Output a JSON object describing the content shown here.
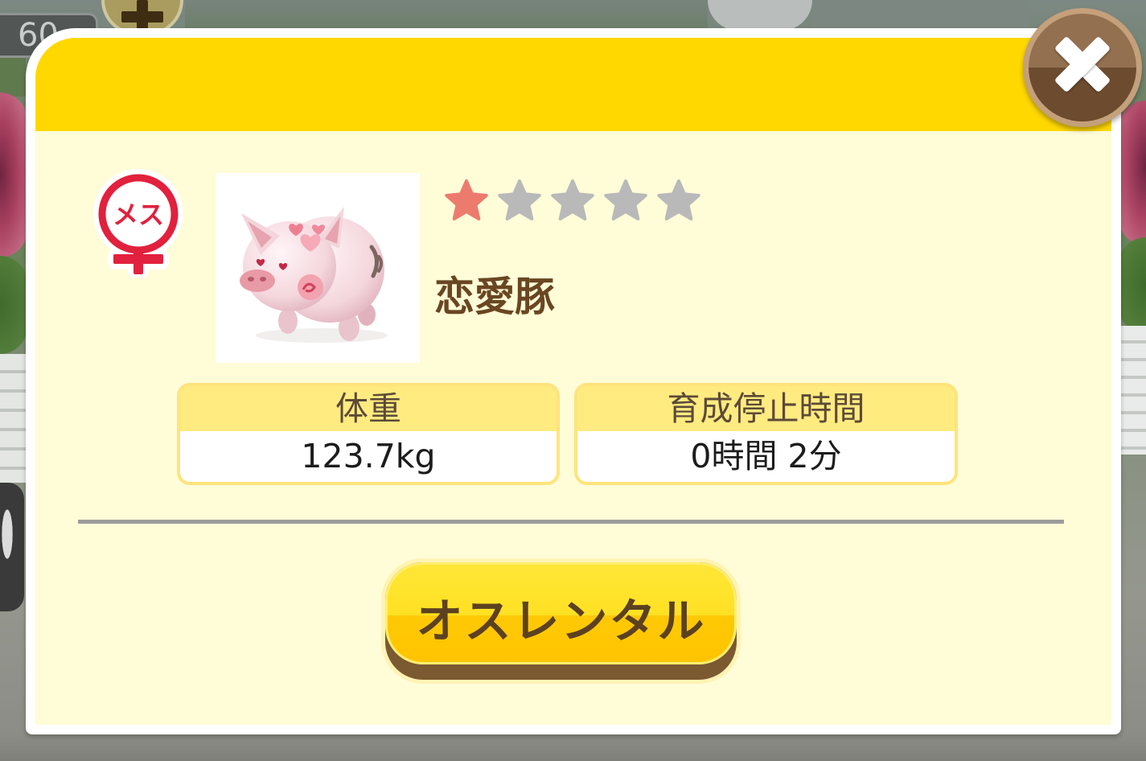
{
  "hud": {
    "counter_value": "60",
    "add_button_icon": "plus-icon"
  },
  "dialog": {
    "close_button_icon": "close-icon",
    "gender": {
      "icon": "female-symbol-icon",
      "label": "メス"
    },
    "pig": {
      "image_icon": "pig-icon",
      "name": "恋愛豚",
      "rarity": 1,
      "rarity_max": 5
    },
    "stats": [
      {
        "label": "体重",
        "value": "123.7kg"
      },
      {
        "label": "育成停止時間",
        "value": "0時間 2分"
      }
    ],
    "action_button": {
      "label": "オスレンタル"
    }
  },
  "theme": {
    "header_yellow": "#FFD800",
    "panel_cream": "#FFFCD8",
    "text_brown": "#6A4623",
    "female_red": "#E1213D",
    "star_filled": "#EC7B6E",
    "star_empty": "#B9B9B9",
    "close_brown": "#7A5738"
  }
}
